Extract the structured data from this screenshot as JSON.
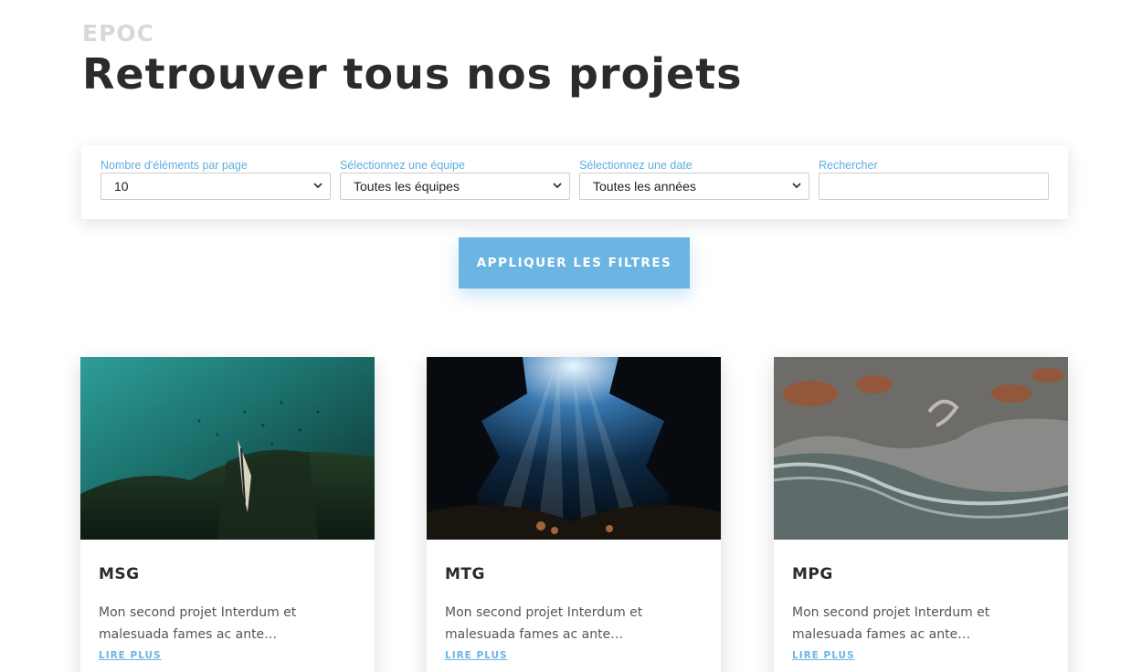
{
  "header": {
    "kicker": "EPOC",
    "title": "Retrouver tous nos projets"
  },
  "filters": {
    "per_page": {
      "label": "Nombre d'éléments par page",
      "value": "10"
    },
    "team": {
      "label": "Sélectionnez une équipe",
      "value": "Toutes les équipes"
    },
    "date": {
      "label": "Sélectionnez une date",
      "value": "Toutes les années"
    },
    "search": {
      "label": "Rechercher",
      "value": "",
      "placeholder": ""
    }
  },
  "apply_button": "APPLIQUER LES FILTRES",
  "cards": [
    {
      "title": "MSG",
      "excerpt": "Mon second projet Interdum et malesuada fames ac ante…",
      "link": "LIRE PLUS",
      "image": "underwater-fish-photo"
    },
    {
      "title": "MTG",
      "excerpt": "Mon second projet Interdum et malesuada fames ac ante…",
      "link": "LIRE PLUS",
      "image": "underwater-cave-light-photo"
    },
    {
      "title": "MPG",
      "excerpt": "Mon second projet Interdum et malesuada fames ac ante…",
      "link": "LIRE PLUS",
      "image": "aerial-coast-photo"
    }
  ],
  "colors": {
    "accent": "#6bb5e3",
    "label": "#5eaee0",
    "title": "#2b2b2b"
  }
}
